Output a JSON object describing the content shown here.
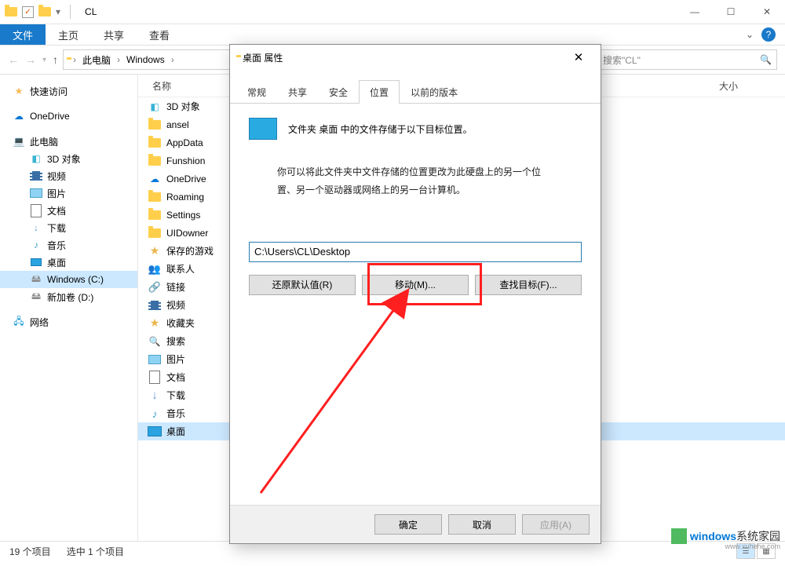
{
  "titlebar": {
    "title": "CL"
  },
  "ribbon": {
    "file": "文件",
    "tabs": [
      "主页",
      "共享",
      "查看"
    ]
  },
  "address": {
    "crumbs": [
      "此电脑",
      "Windows"
    ],
    "search_placeholder": "搜索\"CL\""
  },
  "sidebar": {
    "quick": "快速访问",
    "onedrive": "OneDrive",
    "pc": "此电脑",
    "pc_children": [
      "3D 对象",
      "视频",
      "图片",
      "文档",
      "下载",
      "音乐",
      "桌面",
      "Windows (C:)",
      "新加卷 (D:)"
    ],
    "network": "网络"
  },
  "list": {
    "header_name": "名称",
    "header_size": "大小",
    "items": [
      {
        "icon": "threed",
        "label": "3D 对象"
      },
      {
        "icon": "folder",
        "label": "ansel"
      },
      {
        "icon": "folder",
        "label": "AppData"
      },
      {
        "icon": "folder",
        "label": "Funshion"
      },
      {
        "icon": "cloud",
        "label": "OneDrive"
      },
      {
        "icon": "folder",
        "label": "Roaming"
      },
      {
        "icon": "folder",
        "label": "Settings"
      },
      {
        "icon": "folder",
        "label": "UIDowner"
      },
      {
        "icon": "fav",
        "label": "保存的游戏"
      },
      {
        "icon": "people",
        "label": "联系人"
      },
      {
        "icon": "link",
        "label": "链接"
      },
      {
        "icon": "video",
        "label": "视频"
      },
      {
        "icon": "fav",
        "label": "收藏夹"
      },
      {
        "icon": "search",
        "label": "搜索"
      },
      {
        "icon": "pic",
        "label": "图片"
      },
      {
        "icon": "doc",
        "label": "文档"
      },
      {
        "icon": "dl",
        "label": "下载"
      },
      {
        "icon": "music",
        "label": "音乐"
      },
      {
        "icon": "desktop",
        "label": "桌面",
        "selected": true
      }
    ]
  },
  "status": {
    "count": "19 个项目",
    "selected": "选中 1 个项目"
  },
  "dialog": {
    "title": "桌面 属性",
    "tabs": [
      "常规",
      "共享",
      "安全",
      "位置",
      "以前的版本"
    ],
    "active_tab": 3,
    "line1": "文件夹 桌面 中的文件存储于以下目标位置。",
    "line2a": "你可以将此文件夹中文件存储的位置更改为此硬盘上的另一个位",
    "line2b": "置、另一个驱动器或网络上的另一台计算机。",
    "path": "C:\\Users\\CL\\Desktop",
    "btn_restore": "还原默认值(R)",
    "btn_move": "移动(M)...",
    "btn_find": "查找目标(F)...",
    "btn_ok": "确定",
    "btn_cancel": "取消",
    "btn_apply": "应用(A)"
  },
  "watermark": {
    "brand": "windows",
    "suffix": "系统家园",
    "url": "www.xuhehe.com"
  }
}
